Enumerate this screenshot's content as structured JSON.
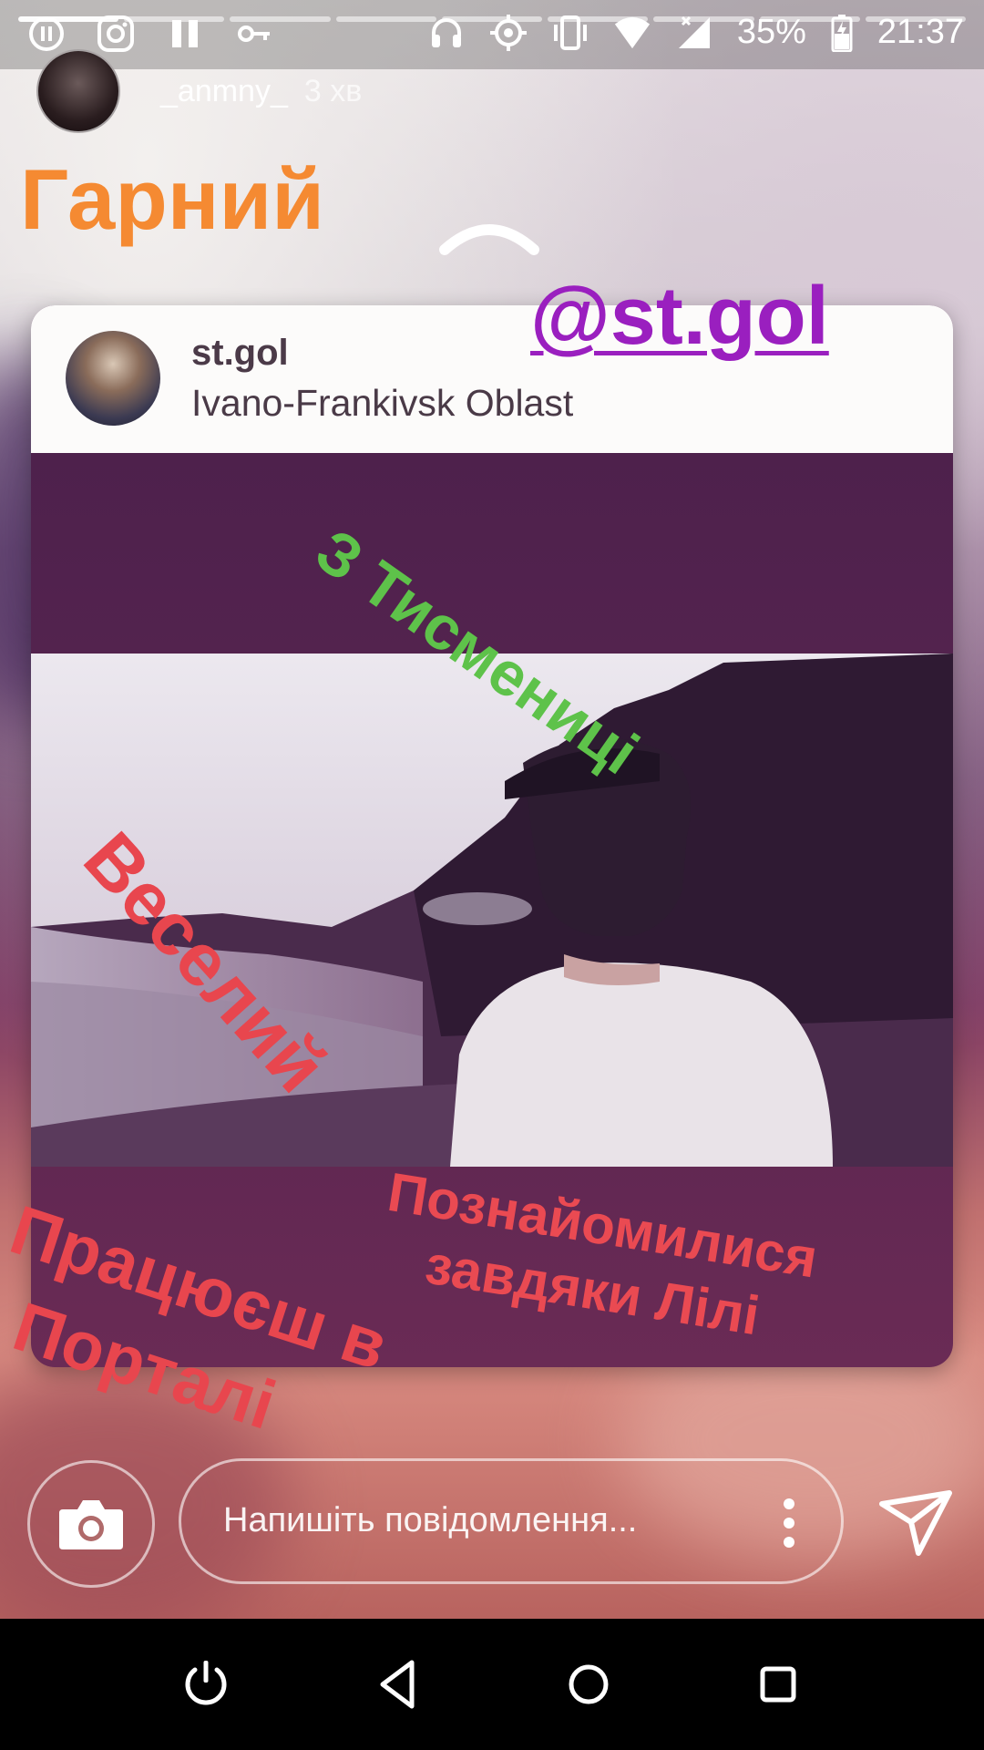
{
  "status_bar": {
    "battery": "35%",
    "time": "21:37"
  },
  "story": {
    "username": "_anmny_",
    "time_ago": "3 хв",
    "progress": {
      "segments": 9,
      "completed": 1
    }
  },
  "stickers": {
    "garnyi": "Гарний",
    "mention": "@st.gol",
    "z_tysmenytsi": "З Тисмениці",
    "veselyi": "Веселий",
    "poznaiomylysia_1": "Познайомилися",
    "poznaiomylysia_2": "завдяки Лілі",
    "pratsiuiesh_1": "Працюєш в",
    "pratsiuiesh_2": "Порталі"
  },
  "shared_post": {
    "username": "st.gol",
    "location": "Ivano-Frankivsk Oblast"
  },
  "reply_bar": {
    "placeholder": "Напишіть повідомлення..."
  },
  "colors": {
    "orange": "#f58a32",
    "purple": "#9a1fbf",
    "green": "#5ec24a",
    "red": "#e8464e"
  }
}
